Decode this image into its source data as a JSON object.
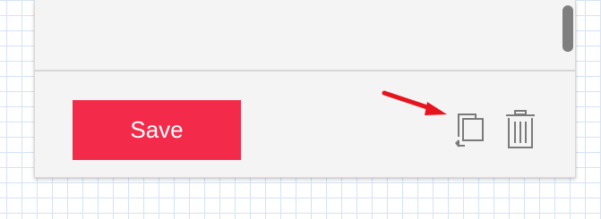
{
  "footer": {
    "save_label": "Save"
  },
  "icons": {
    "duplicate": "duplicate-icon",
    "delete": "trash-icon",
    "annotation": "red-arrow-icon"
  },
  "colors": {
    "save_button": "#f42a4a",
    "annotation_arrow": "#e5141e",
    "panel_background": "#f4f4f4",
    "grid_lines": "#d4e3f6"
  }
}
